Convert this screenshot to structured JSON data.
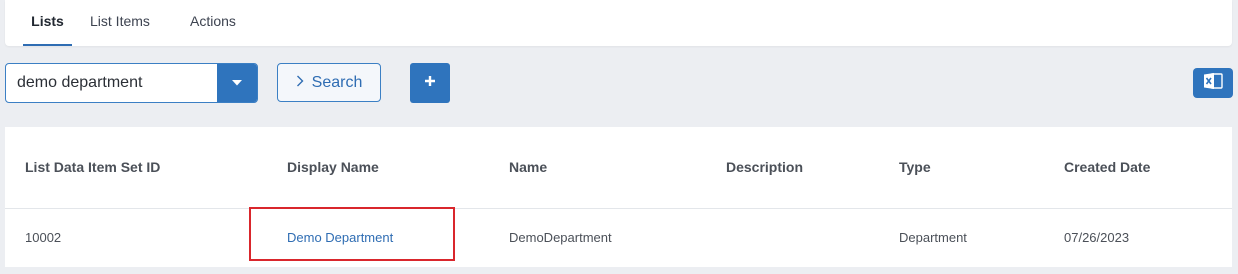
{
  "tabs": [
    {
      "label": "Lists",
      "active": true
    },
    {
      "label": "List Items",
      "active": false
    },
    {
      "label": "Actions",
      "active": false
    }
  ],
  "toolbar": {
    "select_value": "demo department",
    "search_label": "Search",
    "caret_icon": "chevron-down-icon",
    "search_chevron_icon": "chevron-right-icon",
    "add_icon": "plus-icon",
    "export_icon": "excel-icon"
  },
  "table": {
    "columns": [
      "List Data Item Set ID",
      "Display Name",
      "Name",
      "Description",
      "Type",
      "Created Date"
    ],
    "rows": [
      {
        "id": "10002",
        "display_name": "Demo Department",
        "name": "DemoDepartment",
        "description": "",
        "type": "Department",
        "created_date": "07/26/2023"
      }
    ]
  },
  "colors": {
    "accent": "#2f74bd",
    "link": "#2f6db3",
    "highlight": "#d9262c",
    "background": "#eceef2"
  }
}
